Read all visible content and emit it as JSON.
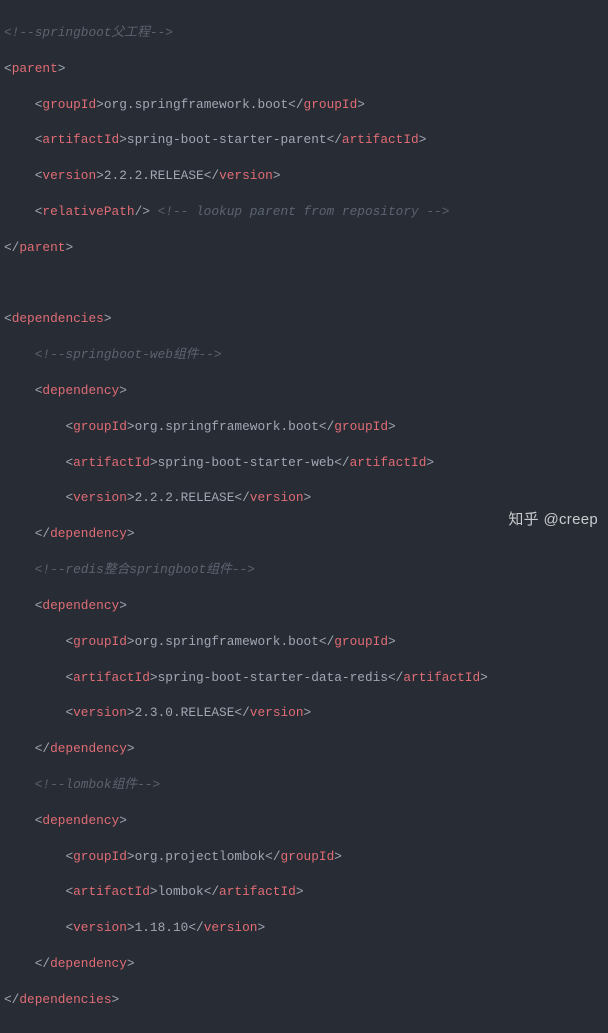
{
  "watermark": "知乎 @creep",
  "code": {
    "t_parent": "parent",
    "t_groupId": "groupId",
    "t_artifactId": "artifactId",
    "t_version": "version",
    "t_relativePath": "relativePath",
    "t_dependencies": "dependencies",
    "t_dependency": "dependency",
    "c_springbootParent": "<!--springboot父工程-->",
    "c_lookup": " <!-- lookup parent from repository -->",
    "c_springbootWeb": "<!--springboot-web组件-->",
    "c_redis": "<!--redis整合springboot组件-->",
    "c_lombok": "<!--lombok组件-->",
    "parent_groupId": "org.springframework.boot",
    "parent_artifactId": "spring-boot-starter-parent",
    "parent_version": "2.2.2.RELEASE",
    "dep1_groupId": "org.springframework.boot",
    "dep1_artifactId": "spring-boot-starter-web",
    "dep1_version": "2.2.2.RELEASE",
    "dep2_groupId": "org.springframework.boot",
    "dep2_artifactId": "spring-boot-starter-data-redis",
    "dep2_version": "2.3.0.RELEASE",
    "dep3_groupId": "org.projectlombok",
    "dep3_artifactId": "lombok",
    "dep3_version": "1.18.10"
  }
}
